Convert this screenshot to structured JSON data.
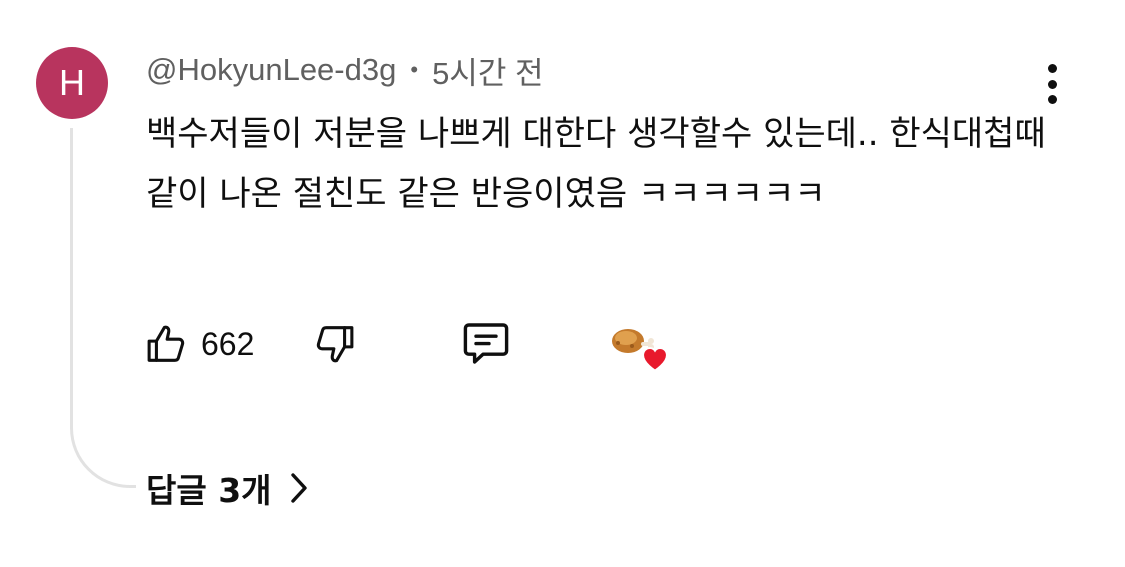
{
  "author": {
    "avatar_letter": "H",
    "handle": "@HokyunLee-d3g",
    "separator": "•",
    "time_ago": "5시간 전"
  },
  "comment": {
    "text": "백수저들이 저분을 나쁘게 대한다 생각할수 있는데.. 한식대첩때 같이 나온 절친도 같은 반응이였음 ㅋㅋㅋㅋㅋㅋ"
  },
  "actions": {
    "like_count": "662",
    "icons": [
      "thumbs-up-icon",
      "thumbs-down-icon",
      "reply-bubble-icon",
      "creator-heart-icon",
      "more-vert-icon",
      "chevron-right-icon"
    ]
  },
  "replies": {
    "label": "답글 3개"
  },
  "colors": {
    "avatar_bg": "#b8345e",
    "text_primary": "#0f0f0f",
    "text_secondary": "#606060",
    "thread_line": "#e2e2e2",
    "heart": "#e8192c"
  }
}
